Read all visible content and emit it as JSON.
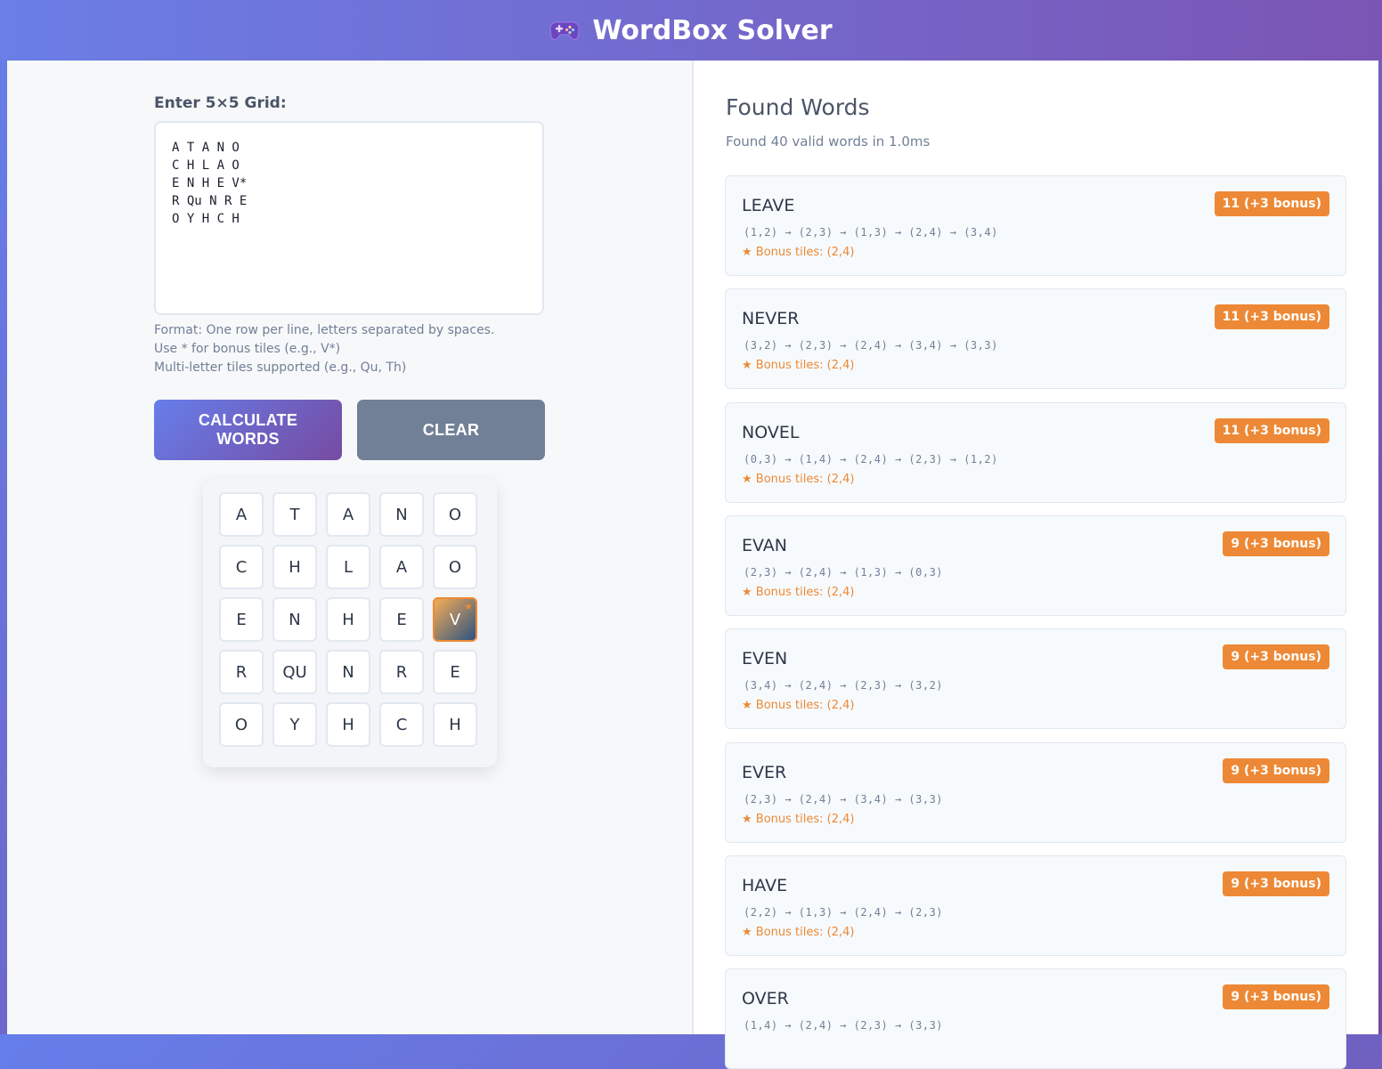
{
  "header": {
    "title": "WordBox Solver",
    "icon": "gamepad-icon"
  },
  "input": {
    "label": "Enter 5×5 Grid:",
    "value": "A T A N O\nC H L A O\nE N H E V*\nR Qu N R E\nO Y H C H",
    "help": [
      "Format: One row per line, letters separated by spaces.",
      "Use * for bonus tiles (e.g., V*)",
      "Multi-letter tiles supported (e.g., Qu, Th)"
    ]
  },
  "buttons": {
    "calculate": "CALCULATE WORDS",
    "clear": "CLEAR"
  },
  "board": {
    "rows": [
      [
        "A",
        "T",
        "A",
        "N",
        "O"
      ],
      [
        "C",
        "H",
        "L",
        "A",
        "O"
      ],
      [
        "E",
        "N",
        "H",
        "E",
        "V"
      ],
      [
        "R",
        "QU",
        "N",
        "R",
        "E"
      ],
      [
        "O",
        "Y",
        "H",
        "C",
        "H"
      ]
    ],
    "bonus_tile": {
      "row": 2,
      "col": 4,
      "marker": "★"
    }
  },
  "results": {
    "title": "Found Words",
    "summary": "Found 40 valid words in 1.0ms",
    "words": [
      {
        "word": "LEAVE",
        "score": "11 (+3 bonus)",
        "path": "(1,2) → (2,3) → (1,3) → (2,4) → (3,4)",
        "bonus": "★ Bonus tiles: (2,4)"
      },
      {
        "word": "NEVER",
        "score": "11 (+3 bonus)",
        "path": "(3,2) → (2,3) → (2,4) → (3,4) → (3,3)",
        "bonus": "★ Bonus tiles: (2,4)"
      },
      {
        "word": "NOVEL",
        "score": "11 (+3 bonus)",
        "path": "(0,3) → (1,4) → (2,4) → (2,3) → (1,2)",
        "bonus": "★ Bonus tiles: (2,4)"
      },
      {
        "word": "EVAN",
        "score": "9 (+3 bonus)",
        "path": "(2,3) → (2,4) → (1,3) → (0,3)",
        "bonus": "★ Bonus tiles: (2,4)"
      },
      {
        "word": "EVEN",
        "score": "9 (+3 bonus)",
        "path": "(3,4) → (2,4) → (2,3) → (3,2)",
        "bonus": "★ Bonus tiles: (2,4)"
      },
      {
        "word": "EVER",
        "score": "9 (+3 bonus)",
        "path": "(2,3) → (2,4) → (3,4) → (3,3)",
        "bonus": "★ Bonus tiles: (2,4)"
      },
      {
        "word": "HAVE",
        "score": "9 (+3 bonus)",
        "path": "(2,2) → (1,3) → (2,4) → (2,3)",
        "bonus": "★ Bonus tiles: (2,4)"
      },
      {
        "word": "OVER",
        "score": "9 (+3 bonus)",
        "path": "(1,4) → (2,4) → (2,3) → (3,3)",
        "bonus": ""
      }
    ]
  },
  "colors": {
    "accent_start": "#667eea",
    "accent_end": "#764ba2",
    "score_badge": "#ed8936"
  }
}
